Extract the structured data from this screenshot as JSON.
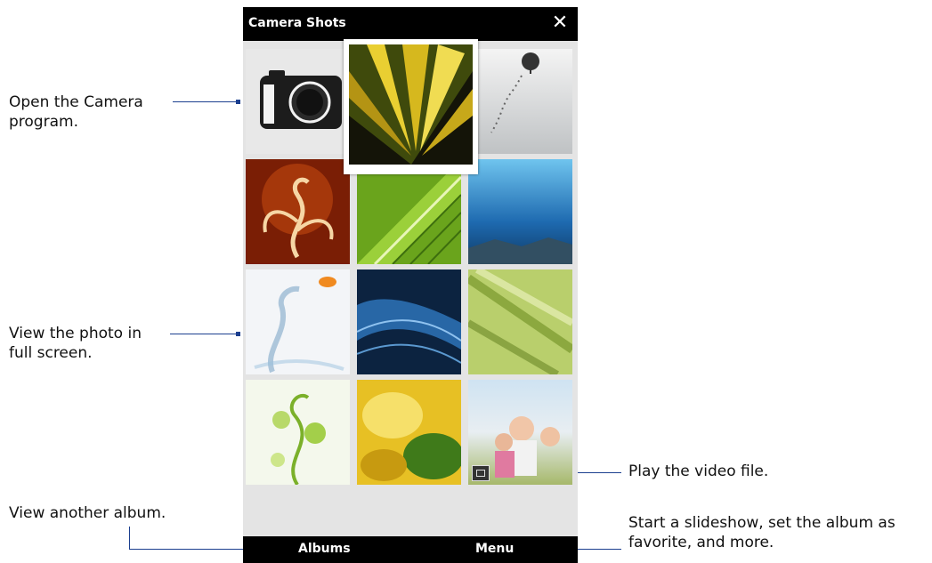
{
  "window": {
    "title": "Camera Shots",
    "close_icon": "close-icon"
  },
  "softkeys": {
    "left_label": "Albums",
    "right_label": "Menu"
  },
  "callouts": {
    "camera": [
      "Open the Camera",
      "program."
    ],
    "fullscreen": [
      "View the photo in",
      "full screen."
    ],
    "album": [
      "View another album."
    ],
    "video": [
      "Play the video file."
    ],
    "menu": [
      "Start a slideshow, set the album as",
      "favorite, and more."
    ]
  },
  "thumbnails": [
    {
      "name": "camera-launcher-icon"
    },
    {
      "name": "flower-photo-selected"
    },
    {
      "name": "snow-tree-photo"
    },
    {
      "name": "floral-ornament-photo"
    },
    {
      "name": "green-leaf-photo"
    },
    {
      "name": "underwater-blue-photo"
    },
    {
      "name": "water-splash-photo"
    },
    {
      "name": "blue-wave-photo"
    },
    {
      "name": "grass-blur-photo"
    },
    {
      "name": "green-vine-photo"
    },
    {
      "name": "yellow-leaves-photo"
    },
    {
      "name": "family-video-thumbnail",
      "badge": "video-icon"
    }
  ],
  "colors": {
    "titlebar": "#000000",
    "grid_background": "#e4e4e4",
    "callout_line": "#1b3f8f"
  }
}
